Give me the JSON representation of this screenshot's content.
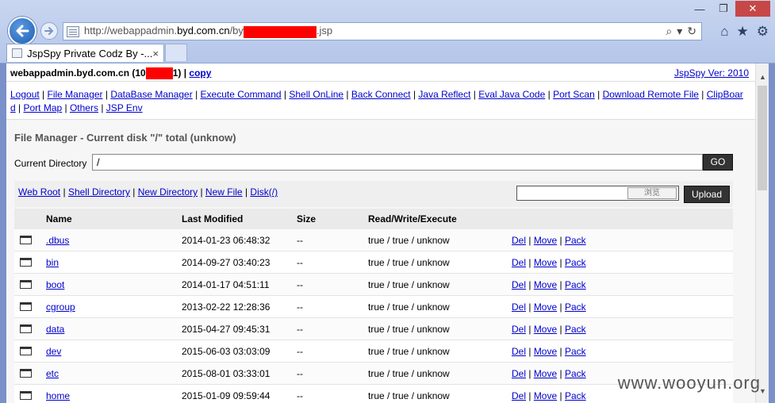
{
  "browser": {
    "url_prefix": "http://webappadmin.",
    "url_host": "byd.com.cn",
    "url_mid": "/by",
    "url_suffix": ".jsp",
    "tab_title": "JspSpy Private Codz By -...",
    "tab_close": "×",
    "window_minimize": "—",
    "window_restore": "❐",
    "window_close": "✕"
  },
  "page": {
    "host_prefix": "webappadmin.byd.com.cn (10",
    "host_suffix": "1)",
    "host_sep": " | ",
    "copy_link": "copy",
    "version": "JspSpy Ver: 2010"
  },
  "menu": {
    "items": [
      "Logout",
      "File Manager",
      "DataBase Manager",
      "Execute Command",
      "Shell OnLine",
      "Back Connect",
      "Java Reflect",
      "Eval Java Code",
      "Port Scan",
      "Download Remote File",
      "ClipBoar",
      "d",
      "Port Map",
      "Others",
      "JSP Env"
    ]
  },
  "file_manager": {
    "title": "File Manager - Current disk \"/\" total (unknow)",
    "current_dir_label": "Current Directory",
    "current_dir_value": "/",
    "go_label": "GO",
    "tool_links": [
      "Web Root",
      "Shell Directory",
      "New Directory",
      "New File",
      "Disk(/)"
    ],
    "browse_label": "浏览",
    "upload_label": "Upload",
    "columns": [
      "Name",
      "Last Modified",
      "Size",
      "Read/Write/Execute"
    ],
    "actions": [
      "Del",
      "Move",
      "Pack"
    ],
    "rows": [
      {
        "name": ".dbus",
        "modified": "2014-01-23 06:48:32",
        "size": "--",
        "rwe": "true / true / unknow"
      },
      {
        "name": "bin",
        "modified": "2014-09-27 03:40:23",
        "size": "--",
        "rwe": "true / true / unknow"
      },
      {
        "name": "boot",
        "modified": "2014-01-17 04:51:11",
        "size": "--",
        "rwe": "true / true / unknow"
      },
      {
        "name": "cgroup",
        "modified": "2013-02-22 12:28:36",
        "size": "--",
        "rwe": "true / true / unknow"
      },
      {
        "name": "data",
        "modified": "2015-04-27 09:45:31",
        "size": "--",
        "rwe": "true / true / unknow"
      },
      {
        "name": "dev",
        "modified": "2015-06-03 03:03:09",
        "size": "--",
        "rwe": "true / true / unknow"
      },
      {
        "name": "etc",
        "modified": "2015-08-01 03:33:01",
        "size": "--",
        "rwe": "true / true / unknow"
      },
      {
        "name": "home",
        "modified": "2015-01-09 09:59:44",
        "size": "--",
        "rwe": "true / true / unknow"
      }
    ]
  },
  "watermark": "www.wooyun.org",
  "colors": {
    "redaction": "#ff0000",
    "link": "#0000cc",
    "button_dark": "#333333"
  },
  "icons": [
    "back-arrow-icon",
    "forward-arrow-icon",
    "page-icon",
    "search-icon",
    "refresh-icon",
    "home-icon",
    "favorites-star-icon",
    "settings-gear-icon",
    "folder-icon"
  ]
}
